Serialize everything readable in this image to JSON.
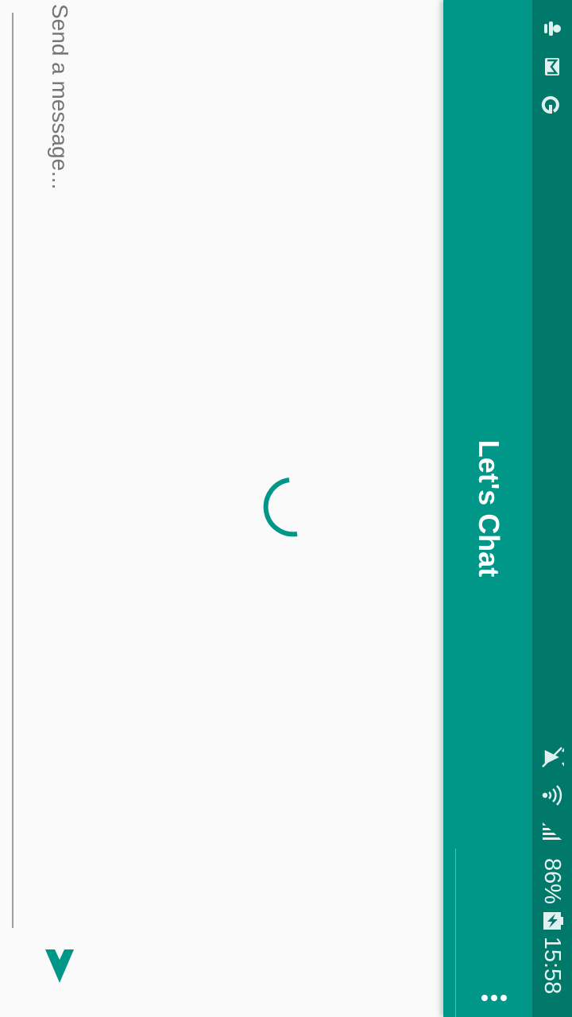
{
  "status_bar": {
    "time": "15:58",
    "battery": "86%",
    "left_icons": [
      "notification-icon",
      "gmail-icon",
      "google-icon"
    ],
    "right_icons": [
      "alarm-off-icon",
      "wifi-icon",
      "signal-icon",
      "battery-charging-icon"
    ]
  },
  "app_bar": {
    "title": "Let's Chat",
    "menu_icon": "overflow-menu-icon"
  },
  "loading": {
    "icon": "loading-spinner"
  },
  "composer": {
    "placeholder": "Send a message...",
    "send_icon": "send-icon"
  },
  "colors": {
    "primary": "#009688",
    "primary_dark": "#00796b",
    "background": "#fafafa",
    "hint": "#757575"
  }
}
